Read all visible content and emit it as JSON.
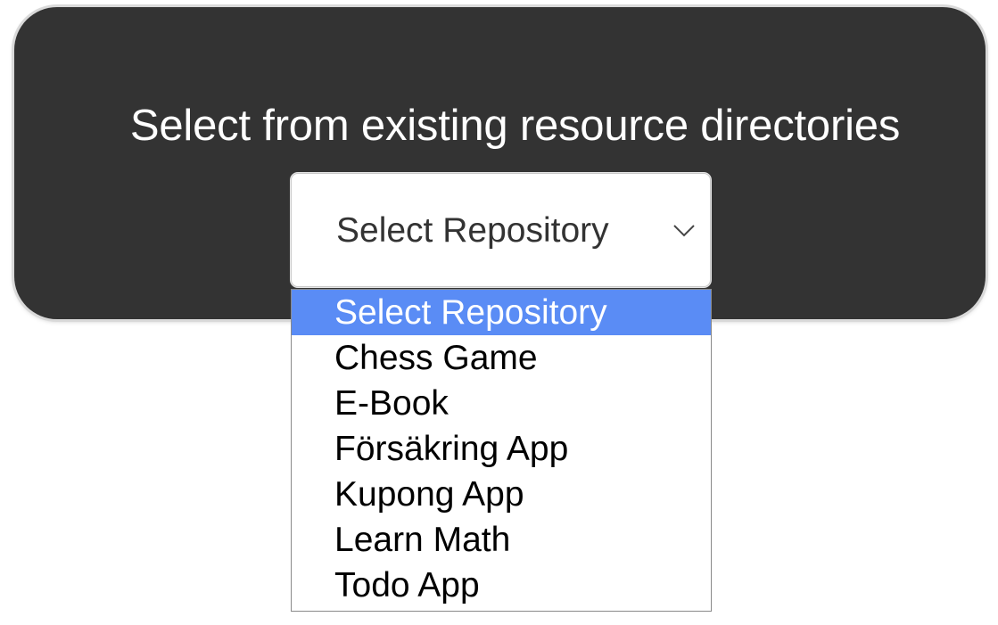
{
  "panel": {
    "title": "Select from existing resource directories"
  },
  "select": {
    "value": "Select Repository",
    "chevron_icon": "chevron-down-icon"
  },
  "dropdown": {
    "options": [
      {
        "label": "Select Repository",
        "selected": true
      },
      {
        "label": "Chess Game",
        "selected": false
      },
      {
        "label": "E-Book",
        "selected": false
      },
      {
        "label": "Försäkring App",
        "selected": false
      },
      {
        "label": "Kupong App",
        "selected": false
      },
      {
        "label": "Learn Math",
        "selected": false
      },
      {
        "label": "Todo App",
        "selected": false
      }
    ],
    "highlight_color": "#5a8cf5"
  },
  "colors": {
    "panel_background": "#333333",
    "panel_text": "#ffffff"
  }
}
